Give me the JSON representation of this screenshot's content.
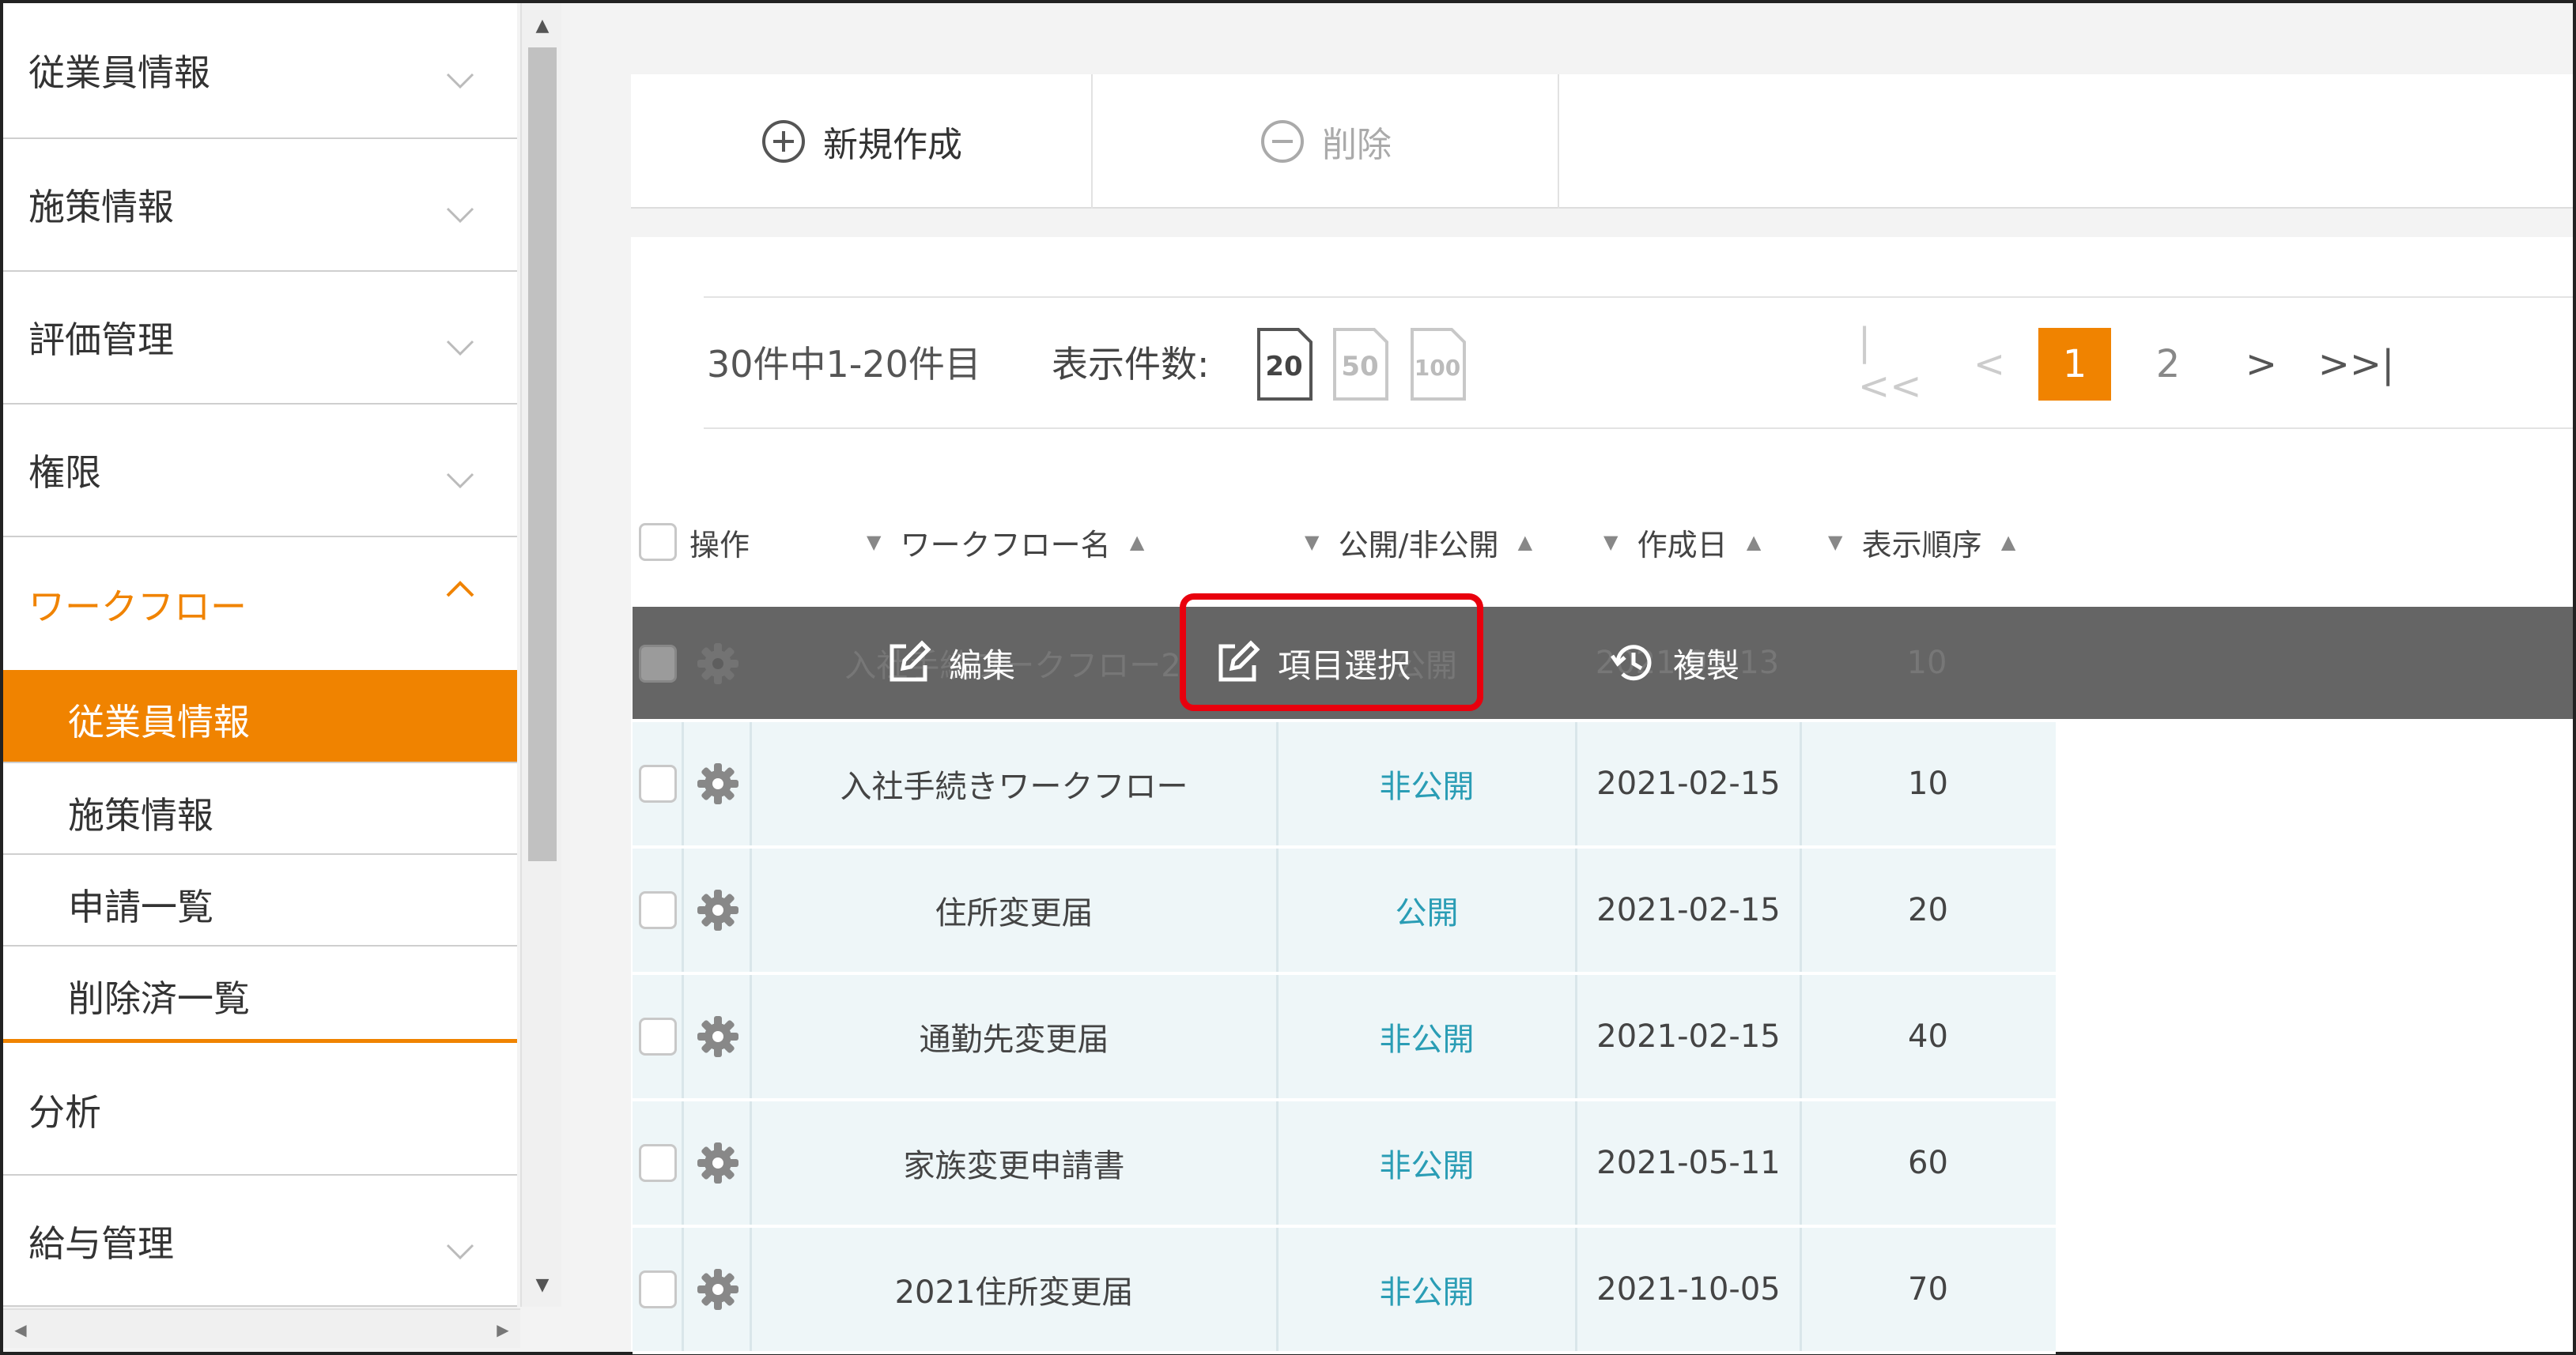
{
  "sidebar": {
    "items": [
      {
        "label": "従業員情報",
        "chevron": "chevron-down-icon"
      },
      {
        "label": "施策情報",
        "chevron": "chevron-down-icon"
      },
      {
        "label": "評価管理",
        "chevron": "chevron-down-icon"
      },
      {
        "label": "権限",
        "chevron": "chevron-down-icon"
      },
      {
        "label": "ワークフロー",
        "chevron": "chevron-up-icon",
        "active": true
      }
    ],
    "subitems": [
      {
        "label": "従業員情報",
        "selected": true
      },
      {
        "label": "施策情報"
      },
      {
        "label": "申請一覧"
      },
      {
        "label": "削除済一覧"
      }
    ],
    "items_after": [
      {
        "label": "分析"
      },
      {
        "label": "給与管理",
        "chevron": "chevron-down-icon"
      }
    ]
  },
  "toolbar": {
    "new_label": "新規作成",
    "delete_label": "削除"
  },
  "pager": {
    "count_text": "30件中1-20件目",
    "per_page_label": "表示件数:",
    "per_page_options": [
      "20",
      "50",
      "100"
    ],
    "per_page_selected": "20",
    "pages": [
      "1",
      "2"
    ],
    "current_page": "1"
  },
  "table": {
    "headers": {
      "action": "操作",
      "name": "ワークフロー名",
      "visibility": "公開/非公開",
      "created": "作成日",
      "order": "表示順序"
    },
    "hover_row": {
      "name": "入社手続ワークフロー2",
      "visibility": "公開",
      "created": "2021-02-13",
      "order": "10"
    },
    "rows": [
      {
        "name": "入社手続きワークフロー",
        "visibility": "非公開",
        "created": "2021-02-15",
        "order": "10"
      },
      {
        "name": "住所変更届",
        "visibility": "公開",
        "created": "2021-02-15",
        "order": "20"
      },
      {
        "name": "通勤先変更届",
        "visibility": "非公開",
        "created": "2021-02-15",
        "order": "40"
      },
      {
        "name": "家族変更申請書",
        "visibility": "非公開",
        "created": "2021-05-11",
        "order": "60"
      },
      {
        "name": "2021住所変更届",
        "visibility": "非公開",
        "created": "2021-10-05",
        "order": "70"
      }
    ]
  },
  "hover_actions": {
    "edit_label": "編集",
    "select_label": "項目選択",
    "copy_label": "複製"
  },
  "colors": {
    "accent": "#f08300",
    "public_text": "#2a9db5",
    "highlight": "#e8000d"
  }
}
